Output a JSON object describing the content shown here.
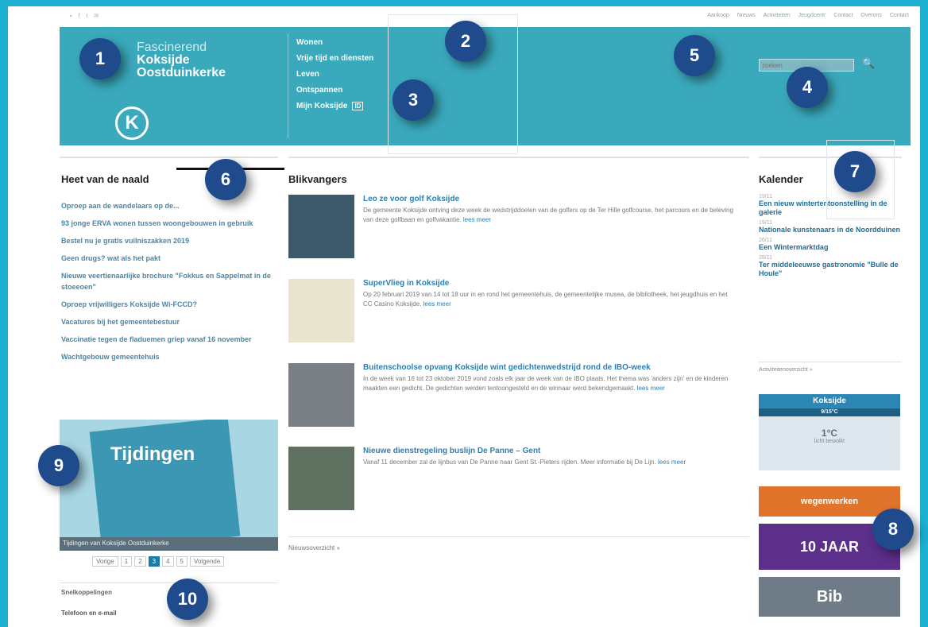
{
  "topbar": {
    "social": "▪ f t ✉",
    "links": [
      "Aankoop",
      "Nieuws",
      "Activiteiten",
      "Jeugdcentr",
      "Contact",
      "Overons",
      "Contact"
    ]
  },
  "header": {
    "logo_line1": "Fascinerend",
    "logo_line2": "Koksijde",
    "logo_line3": "Oostduinkerke",
    "logo_mark": "K",
    "nav": [
      "Wonen",
      "Vrije tijd en diensten",
      "Leven",
      "Ontspannen",
      "Mijn Koksijde"
    ],
    "nav_badge": "ID",
    "search_placeholder": "zoeken",
    "search_icon_glyph": "🔍"
  },
  "left": {
    "heading": "Heet van de naald",
    "news": [
      "Oproep aan de wandelaars op de...",
      "93 jonge ERVA wonen tussen woongebouwen in gebruik",
      "Bestel nu je gratis vuilniszakken 2019",
      "Geen drugs? wat als het pakt",
      "Nieuwe veertienaarlijke brochure \"Fokkus en Sappelmat in de stoeeoen\"",
      "Oproep vrijwilligers Koksijde Wi-FCCD?",
      "Vacatures bij het gemeentebestuur",
      "Vaccinatie tegen de fladuemen griep vanaf 16 november",
      "Wachtgebouw gemeentehuis"
    ],
    "promo_title": "Tijdingen",
    "promo_caption": "Tijdingen van Koksijde Oostduinkerke",
    "pager": [
      "Vorige",
      "1",
      "2",
      "3",
      "4",
      "5",
      "Volgende"
    ],
    "pager_active": "3",
    "footer_title": "Snelkoppelingen",
    "footer_item": "Telefoon en e-mail"
  },
  "center": {
    "heading": "Blikvangers",
    "stories": [
      {
        "title": "Leo ze voor golf Koksijde",
        "body": "De gemeente Koksijde ontving deze week de wedstrijddoelen van de golfers op de Ter Hille golfcourse, het parcours en de beleving van deze golfbaan en golfvakantie.",
        "more": "lees meer"
      },
      {
        "title": "SuperVlieg in Koksijde",
        "body": "Op 20 februari 2019 van 14 tot 18 uur in en rond het gemeentehuis, de gemeentelijke musea, de bibliotheek, het jeugdhuis en het CC Casino Koksijde.",
        "more": "lees meer"
      },
      {
        "title": "Buitenschoolse opvang Koksijde wint gedichtenwedstrijd rond de IBO-week",
        "body": "In de week van 16 tot 23 oktober 2019 vond zoals elk jaar de week van de IBO plaats. Het thema was 'anders zijn' en de kinderen maakten een gedicht. De gedichten werden tentoongesteld en de winnaar werd bekendgemaakt.",
        "more": "lees meer"
      },
      {
        "title": "Nieuwe dienstregeling buslijn De Panne – Gent",
        "body": "Vanaf 11 december zal de lijnbus van De Panne naar Gent St.-Pieters rijden. Meer informatie bij De Lijn.",
        "more": "lees meer"
      }
    ],
    "more": "Nieuwsoverzicht »"
  },
  "right": {
    "heading": "Kalender",
    "events": [
      {
        "date": "19/11",
        "title": "Een nieuw wintertentoonstelling in de galerie"
      },
      {
        "date": "19/11",
        "title": "Nationale kunstenaars in de Noordduinen"
      },
      {
        "date": "26/11",
        "title": "Een Wintermarktdag"
      },
      {
        "date": "28/11",
        "title": "Ter middeleeuwse gastronomie \"Bulle de Houle\""
      }
    ],
    "more": "Activiteitenoverzicht »",
    "weather_title": "Koksijde",
    "weather_date": "9/15°C",
    "weather_temp": "1°C",
    "weather_text": "licht bewolkt",
    "banner_wegen": "wegenwerken",
    "banner_10jaar": "10 JAAR",
    "banner_bib": "Bib"
  },
  "badges": [
    "1",
    "2",
    "3",
    "4",
    "5",
    "6",
    "7",
    "8",
    "9",
    "10"
  ],
  "colors": {
    "background": "#1cb0d4",
    "header": "#3aa9bc",
    "badge": "#1f4a8c",
    "link": "#2c7fb0"
  }
}
